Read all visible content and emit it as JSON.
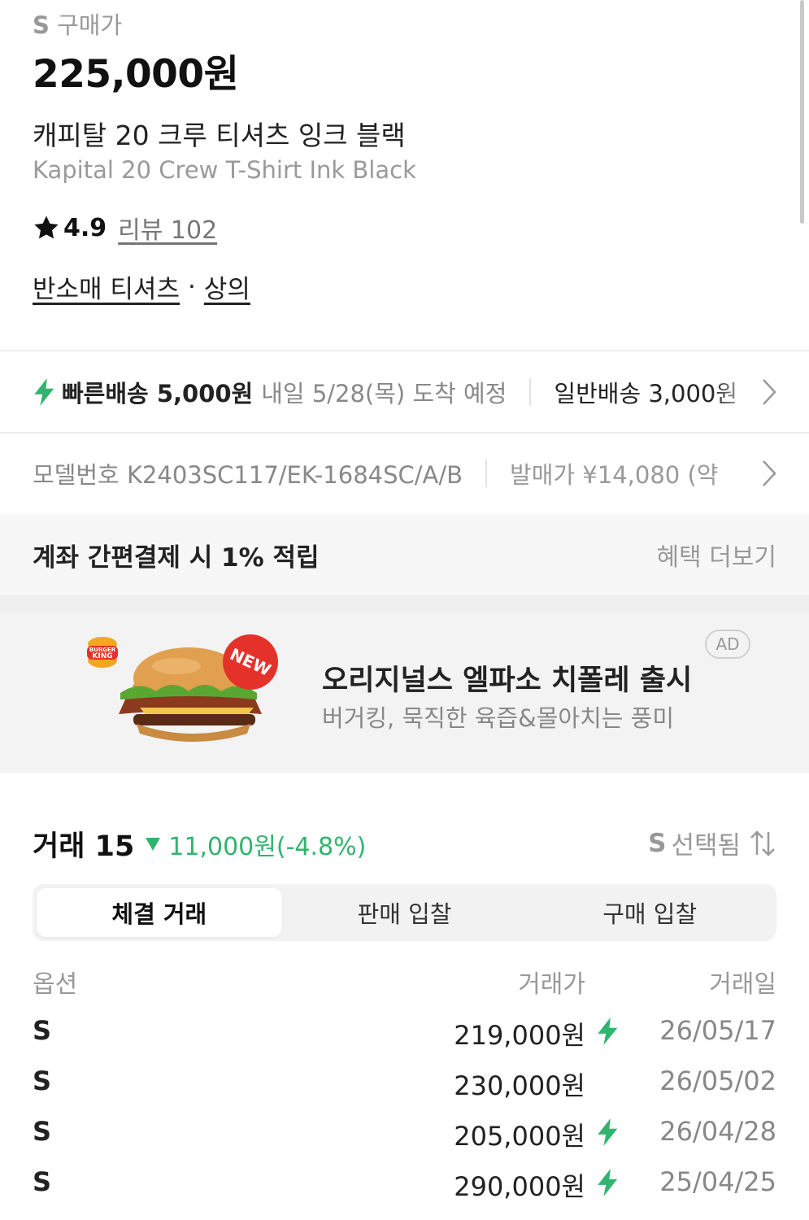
{
  "product": {
    "price_size": "S",
    "price_label": "구매가",
    "price": "225,000원",
    "name_ko": "캐피탈 20 크루 티셔츠 잉크 블랙",
    "name_en": "Kapital 20 Crew T-Shirt Ink Black",
    "rating": "4.9",
    "review": "리뷰 102",
    "category_1": "반소매 티셔츠",
    "category_sep": "·",
    "category_2": "상의"
  },
  "shipping": {
    "fast_label": "빠른배송 5,000원",
    "fast_eta": "내일 5/28(목) 도착 예정",
    "normal_label": "일반배송 3,000원"
  },
  "info": {
    "model": "모델번호 K2403SC117/EK-1684SC/A/B",
    "release_price": "발매가 ¥14,080 (약"
  },
  "benefit": {
    "text": "계좌 간편결제 시 1% 적립",
    "more": "혜택 더보기"
  },
  "ad": {
    "title": "오리지널스 엘파소 치폴레 출시",
    "subtitle": "버거킹, 묵직한 육즙&몰아치는 풍미",
    "badge": "AD",
    "logo_text_1": "BURGER",
    "logo_text_2": "KING",
    "new_badge": "NEW"
  },
  "trades": {
    "title": "거래 15",
    "change": "11,000원(-4.8%)",
    "size_selected": "S",
    "size_selected_label": "선택됨",
    "tabs": [
      "체결 거래",
      "판매 입찰",
      "구매 입찰"
    ],
    "columns": [
      "옵션",
      "거래가",
      "거래일"
    ],
    "rows": [
      {
        "option": "S",
        "price": "219,000원",
        "fast": true,
        "date": "26/05/17"
      },
      {
        "option": "S",
        "price": "230,000원",
        "fast": false,
        "date": "26/05/02"
      },
      {
        "option": "S",
        "price": "205,000원",
        "fast": true,
        "date": "26/04/28"
      },
      {
        "option": "S",
        "price": "290,000원",
        "fast": true,
        "date": "25/04/25"
      }
    ]
  },
  "colors": {
    "accent_green": "#31b46e",
    "text_dark": "#222222",
    "text_muted": "#999999"
  }
}
